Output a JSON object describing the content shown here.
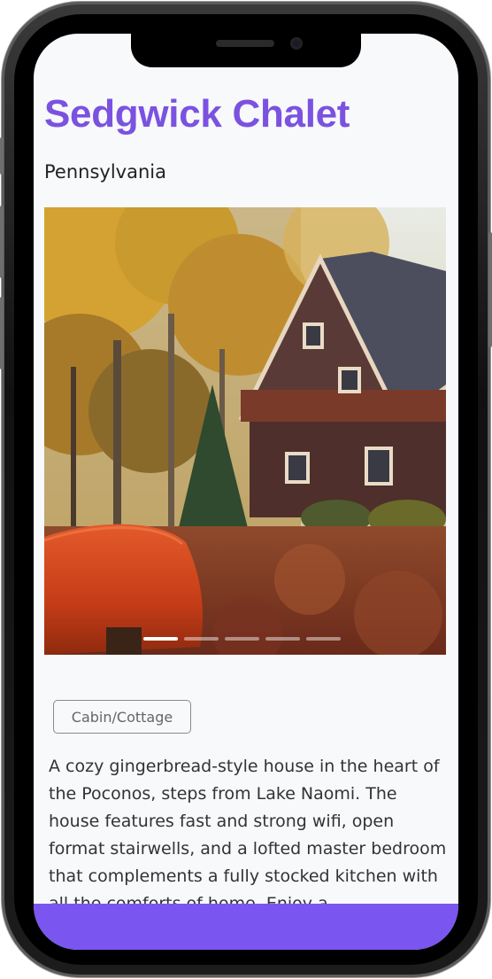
{
  "listing": {
    "title": "Sedgwick Chalet",
    "location": "Pennsylvania",
    "category": "Cabin/Cottage",
    "description": "A cozy gingerbread-style house in the heart of the Poconos, steps from Lake Naomi. The house features fast and strong wifi, open format stairwells, and a lofted master bedroom that complements a fully stocked kitchen with all the comforts of home. Enjoy a"
  },
  "carousel": {
    "slide_count": 5,
    "active_index": 0
  },
  "colors": {
    "accent": "#7b52e0",
    "bottom_bar": "#7b55ef",
    "background": "#f7f9fb"
  }
}
